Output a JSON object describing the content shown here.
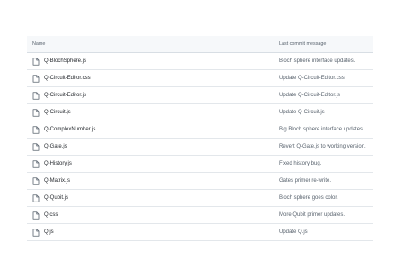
{
  "table": {
    "headers": {
      "name": "Name",
      "message": "Last commit message"
    },
    "rows": [
      {
        "name": "Q-BlochSphere.js",
        "message": "Bloch sphere interface updates.",
        "icon": "file-icon"
      },
      {
        "name": "Q-Circuit-Editor.css",
        "message": "Update Q-Circuit-Editor.css",
        "icon": "file-icon"
      },
      {
        "name": "Q-Circuit-Editor.js",
        "message": "Update Q-Circuit-Editor.js",
        "icon": "file-icon"
      },
      {
        "name": "Q-Circuit.js",
        "message": "Update Q-Circuit.js",
        "icon": "file-icon"
      },
      {
        "name": "Q-ComplexNumber.js",
        "message": "Big Bloch sphere interface updates.",
        "icon": "file-icon"
      },
      {
        "name": "Q-Gate.js",
        "message": "Revert Q-Gate.js to working version.",
        "icon": "file-icon"
      },
      {
        "name": "Q-History.js",
        "message": "Fixed history bug.",
        "icon": "file-icon"
      },
      {
        "name": "Q-Matrix.js",
        "message": "Gates primer re-write.",
        "icon": "file-icon"
      },
      {
        "name": "Q-Qubit.js",
        "message": "Bloch sphere goes color.",
        "icon": "file-icon"
      },
      {
        "name": "Q.css",
        "message": "More Qubit primer updates.",
        "icon": "file-icon"
      },
      {
        "name": "Q.js",
        "message": "Update Q.js",
        "icon": "file-icon"
      }
    ]
  }
}
